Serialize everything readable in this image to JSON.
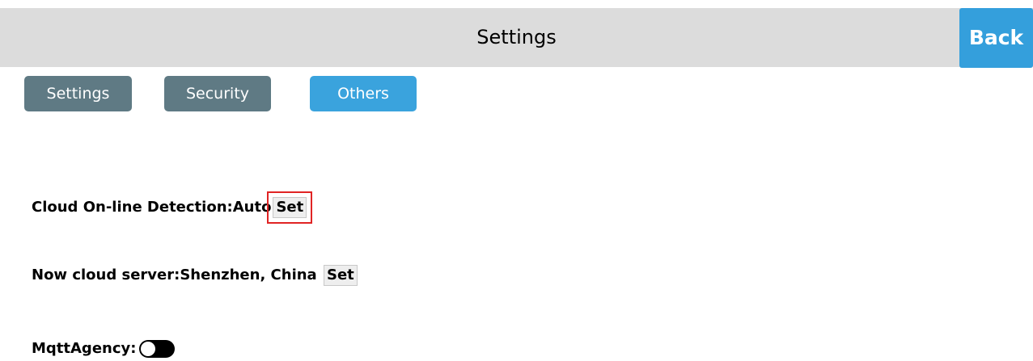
{
  "header": {
    "title": "Settings",
    "back_label": "Back"
  },
  "tabs": [
    {
      "label": "Settings",
      "active": false
    },
    {
      "label": "Security",
      "active": false
    },
    {
      "label": "Others",
      "active": true
    }
  ],
  "settings": {
    "cloud_detection": {
      "label": "Cloud On-line Detection:",
      "value": "Auto",
      "button_label": "Set"
    },
    "cloud_server": {
      "label": "Now cloud server:",
      "value": "Shenzhen, China",
      "button_label": "Set"
    },
    "mqtt_agency": {
      "label": "MqttAgency:",
      "enabled": false
    }
  },
  "colors": {
    "header_bg": "#dcdcdc",
    "accent": "#349fdc",
    "tab_inactive": "#5f7a84",
    "tab_active": "#3aa3dd",
    "highlight": "#e02424"
  }
}
